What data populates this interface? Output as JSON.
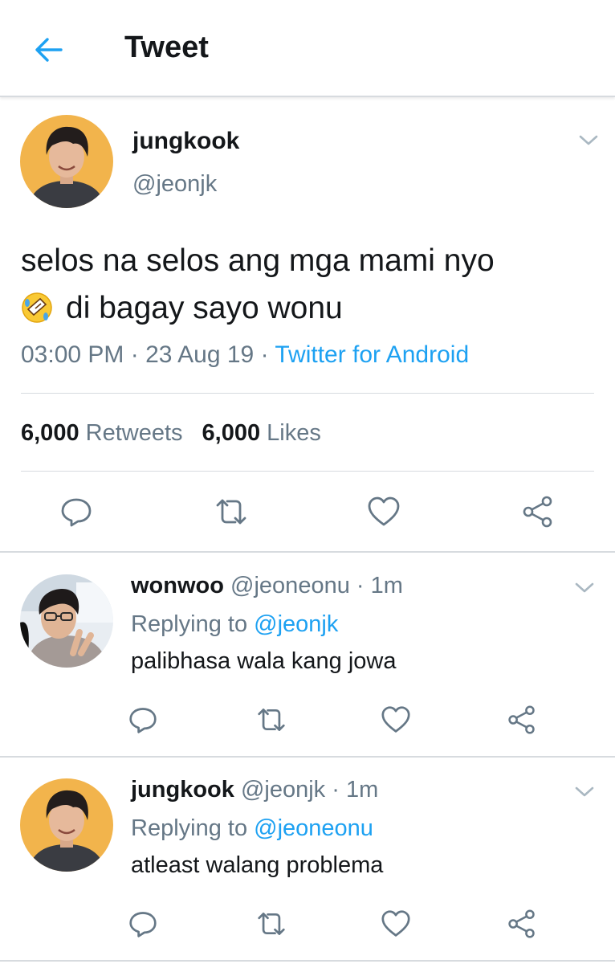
{
  "header": {
    "title": "Tweet",
    "back_icon": "arrow-left-icon"
  },
  "colors": {
    "accent": "#1da1f2",
    "secondary_text": "#657786",
    "primary_text": "#14171a",
    "divider": "#d7dbdf",
    "avatar_bg": "#f2b44c"
  },
  "main_tweet": {
    "name": "jungkook",
    "handle": "@jeonjk",
    "text_line1": "selos na selos ang mga mami nyo",
    "emoji": "rolling-on-the-floor-laughing-emoji",
    "text_line2": "di bagay sayo wonu",
    "time": "03:00 PM",
    "date": "23 Aug 19",
    "separator": " · ",
    "source": "Twitter for Android",
    "retweets_count": "6,000",
    "retweets_label": "Retweets",
    "likes_count": "6,000",
    "likes_label": "Likes"
  },
  "replies": [
    {
      "name": "wonwoo",
      "handle": "@jeoneonu",
      "time": "· 1m",
      "replying_prefix": "Replying to",
      "replying_to": "@jeonjk",
      "text": "palibhasa wala kang jowa"
    },
    {
      "name": "jungkook",
      "handle": "@jeonjk",
      "time": "· 1m",
      "replying_prefix": "Replying to",
      "replying_to": "@jeoneonu",
      "text": "atleast walang problema"
    }
  ],
  "action_icons": [
    "reply-icon",
    "retweet-icon",
    "like-icon",
    "share-icon"
  ]
}
